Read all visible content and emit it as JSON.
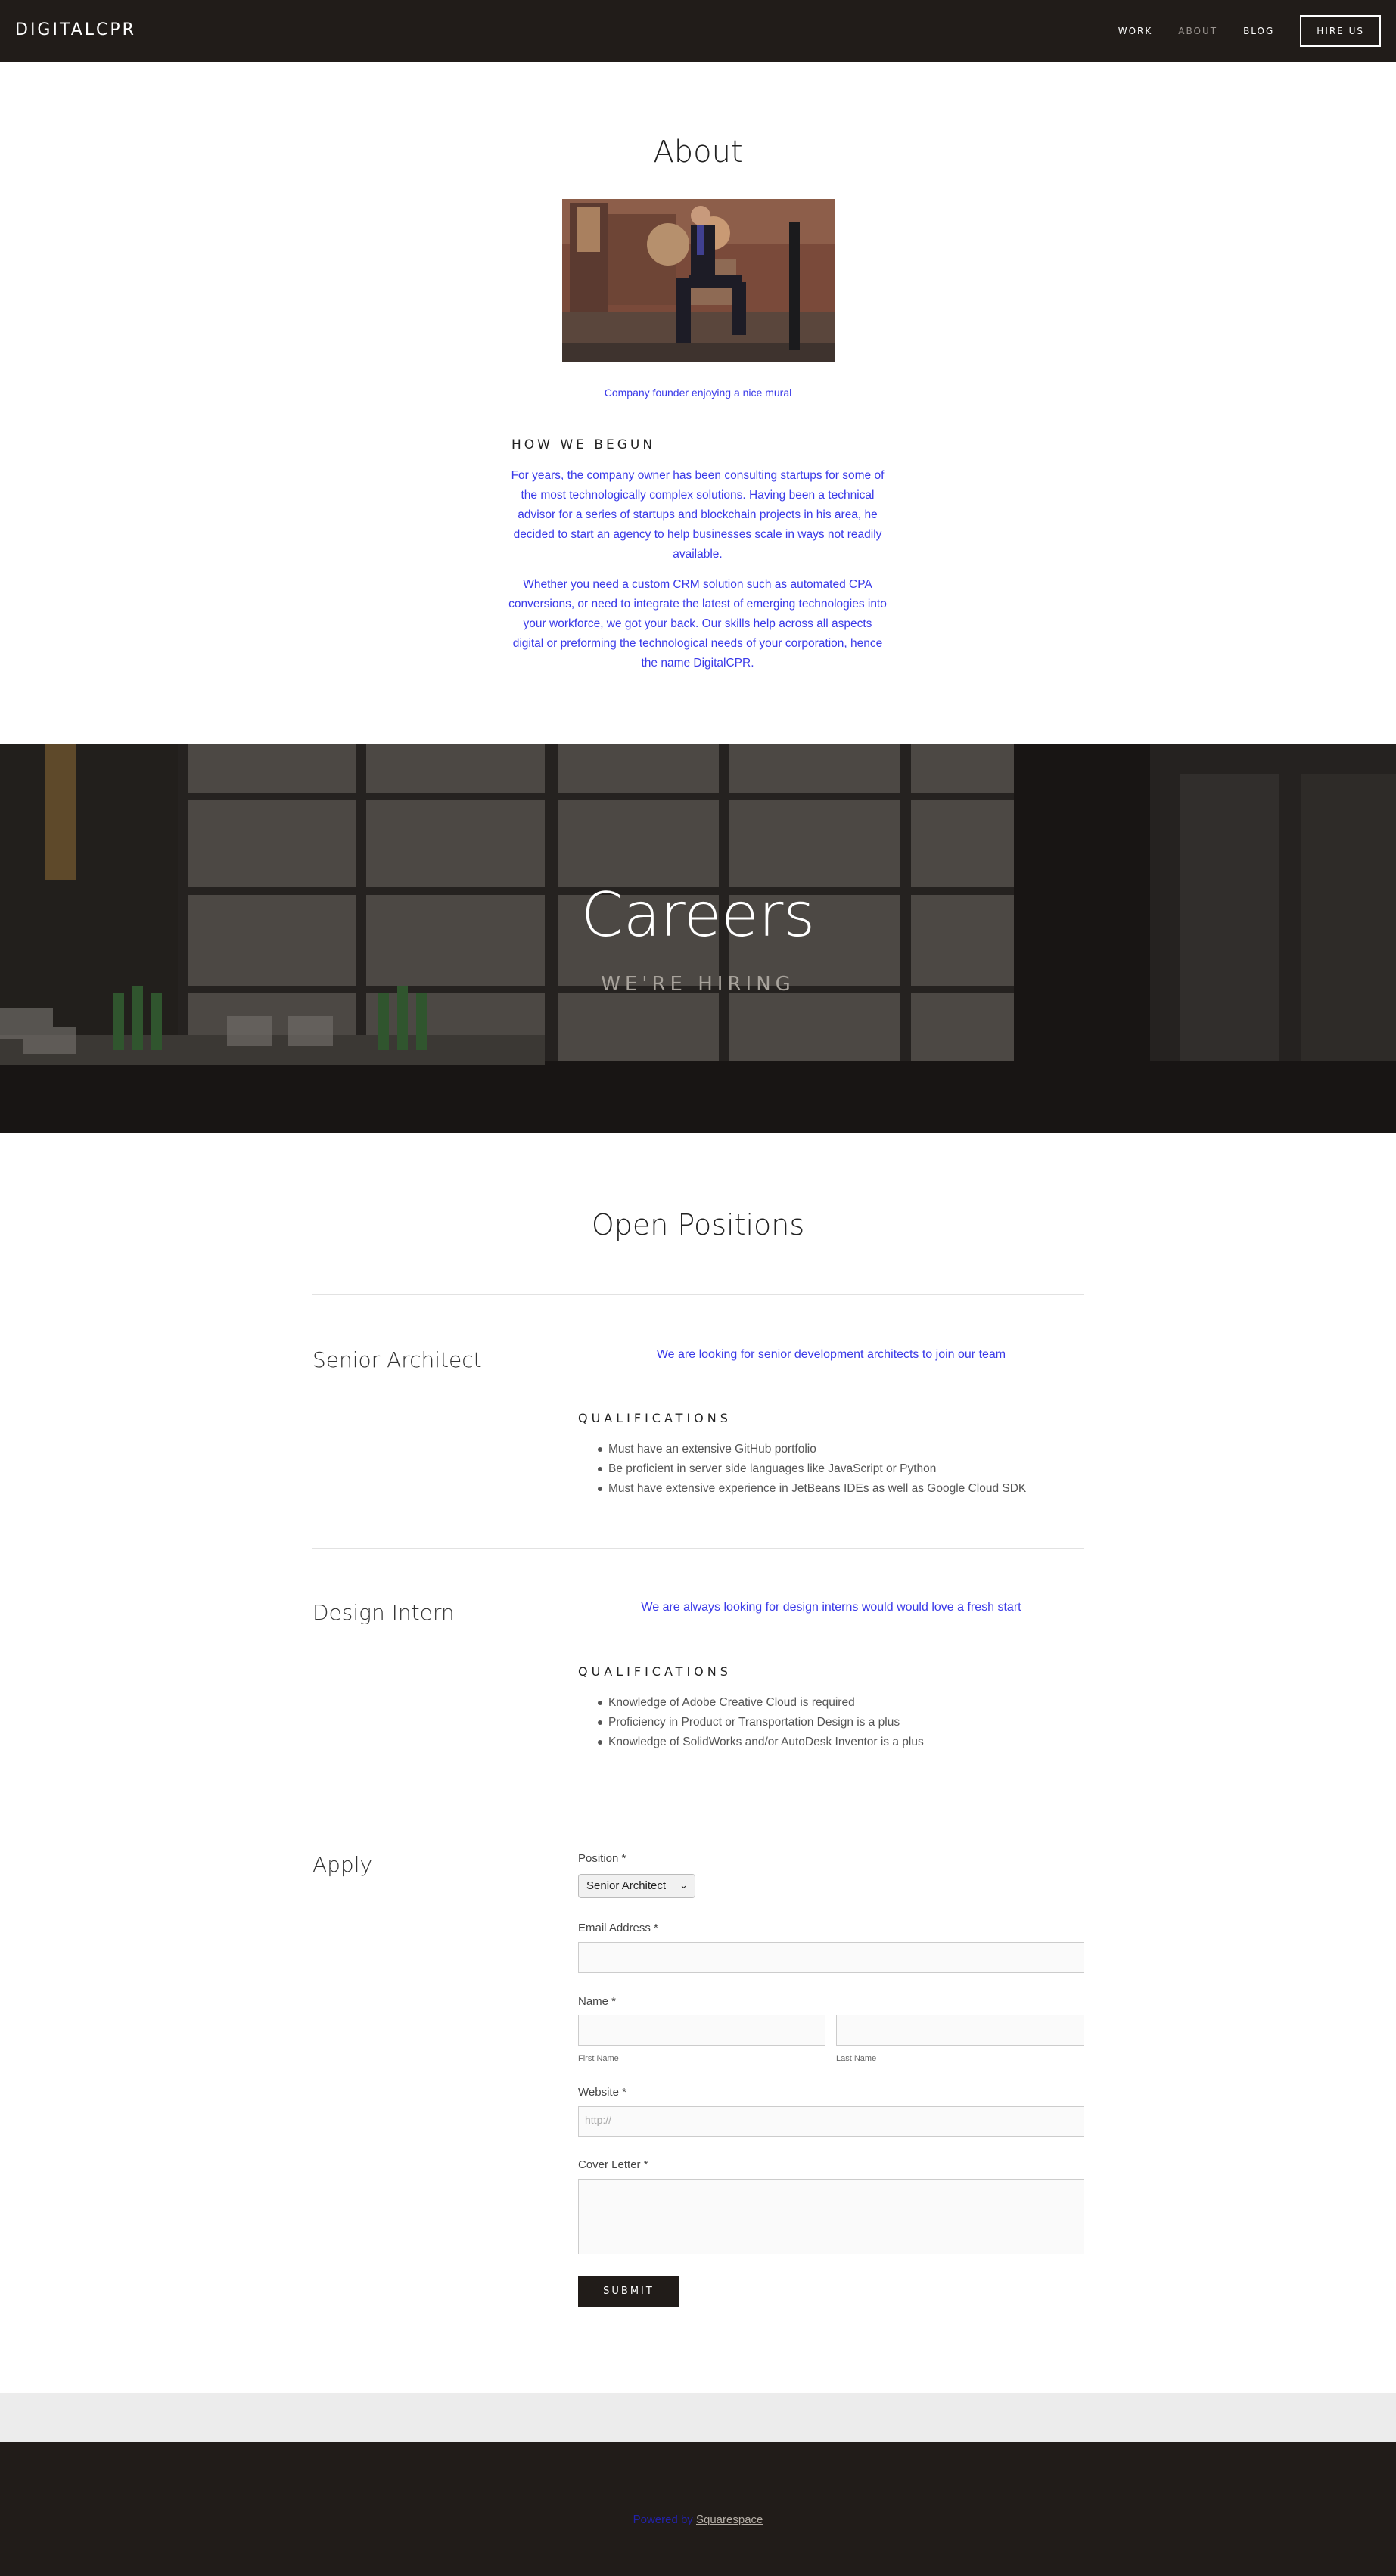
{
  "header": {
    "logo": "DIGITALCPR",
    "nav": [
      {
        "label": "WORK"
      },
      {
        "label": "ABOUT"
      },
      {
        "label": "BLOG"
      }
    ],
    "hire_label": "HIRE US"
  },
  "about": {
    "title": "About",
    "caption": "Company founder enjoying a nice mural",
    "heading": "HOW WE BEGUN",
    "paragraphs": [
      "For years, the company owner has been consulting startups for some of the most technologically complex solutions. Having been a technical advisor for a series of startups and blockchain projects in his area, he decided to start an agency to help businesses scale in ways not readily available.",
      "Whether you need a custom CRM solution such as automated CPA conversions, or need to integrate the latest of emerging technologies into your workforce, we got your back. Our skills help across all aspects digital or preforming the technological needs of your corporation, hence the name DigitalCPR."
    ]
  },
  "banner": {
    "title": "Careers",
    "subtitle": "WE'RE HIRING"
  },
  "positions": {
    "title": "Open Positions",
    "qualifications_heading": "QUALIFICATIONS",
    "jobs": [
      {
        "title": "Senior Architect",
        "description": "We are looking for senior development architects to join our team",
        "qualifications": [
          "Must have an extensive GitHub portfolio",
          "Be proficient in server side languages like JavaScript or Python",
          "Must have extensive experience in JetBeans IDEs as well as Google Cloud SDK"
        ]
      },
      {
        "title": "Design Intern",
        "description": "We are always looking for design interns would would love a fresh start",
        "qualifications": [
          "Knowledge of Adobe Creative Cloud is required",
          "Proficiency in Product or Transportation Design is a plus",
          "Knowledge of SolidWorks and/or AutoDesk Inventor is a plus"
        ]
      }
    ]
  },
  "apply": {
    "title": "Apply",
    "position_label": "Position *",
    "position_value": "Senior Architect",
    "email_label": "Email Address *",
    "name_label": "Name *",
    "first_name_label": "First Name",
    "last_name_label": "Last Name",
    "website_label": "Website *",
    "website_placeholder": "http://",
    "cover_letter_label": "Cover Letter *",
    "submit_label": "SUBMIT"
  },
  "footer": {
    "powered_by": "Powered by",
    "link": "Squarespace"
  },
  "colors": {
    "dark": "#211c19",
    "link_blue": "#3a3ae8"
  }
}
